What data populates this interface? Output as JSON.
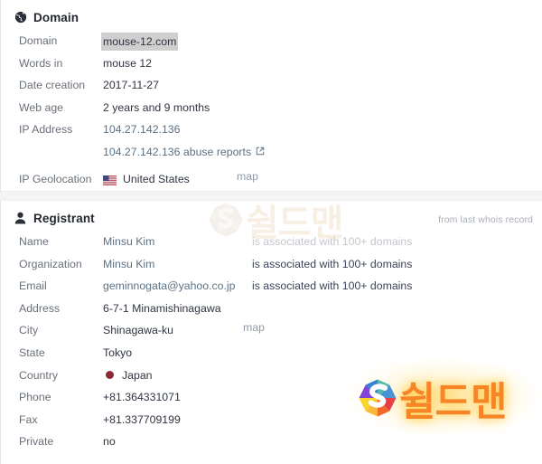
{
  "domain_section": {
    "title": "Domain",
    "icon": "globe-icon",
    "rows": [
      {
        "label": "Domain",
        "value": "mouse-12.com",
        "style": "highlight"
      },
      {
        "label": "Words in",
        "value": "mouse 12",
        "style": "text"
      },
      {
        "label": "Date creation",
        "value": "2017-11-27",
        "style": "text"
      },
      {
        "label": "Web age",
        "value": "2 years and 9 months",
        "style": "text"
      },
      {
        "label": "IP Address",
        "value": "104.27.142.136",
        "style": "link"
      }
    ],
    "abuse_row": {
      "label": "",
      "value": "104.27.142.136 abuse reports",
      "icon": "external-link-icon"
    },
    "geolocation_row": {
      "label": "IP Geolocation",
      "value": "United States",
      "flag": "us-flag-icon",
      "map_label": "map"
    }
  },
  "registrant_section": {
    "title": "Registrant",
    "icon": "person-icon",
    "note": "from last whois record",
    "assoc_text": "is associated with 100+ domains",
    "rows": [
      {
        "label": "Name",
        "value": "Minsu Kim",
        "style": "link",
        "extra": "is associated with 100+ domains",
        "extra_muted": true
      },
      {
        "label": "Organization",
        "value": "Minsu Kim",
        "style": "link",
        "extra": "is associated with 100+ domains",
        "extra_muted": false
      },
      {
        "label": "Email",
        "value": "geminnogata@yahoo.co.jp",
        "style": "link",
        "extra": "is associated with 100+ domains",
        "extra_muted": false
      },
      {
        "label": "Address",
        "value": "6-7-1 Minamishinagawa",
        "style": "text"
      },
      {
        "label": "City",
        "value": "Shinagawa-ku",
        "style": "text",
        "map_label": "map"
      },
      {
        "label": "State",
        "value": "Tokyo",
        "style": "text"
      },
      {
        "label": "Country",
        "value": "Japan",
        "style": "flag",
        "flag": "jp-flag-icon"
      },
      {
        "label": "Phone",
        "value": "+81.364331071",
        "style": "text"
      },
      {
        "label": "Fax",
        "value": "+81.337709199",
        "style": "text"
      },
      {
        "label": "Private",
        "value": "no",
        "style": "text"
      }
    ]
  },
  "watermarks": {
    "top": {
      "text": "쉴드맨",
      "emblem": "shieldman-s-logo"
    },
    "bottom": {
      "text": "쉴드맨",
      "emblem": "shieldman-s-logo"
    }
  },
  "colors": {
    "link": "#5b7184",
    "label": "#6a7079",
    "value": "#2f3440",
    "muted": "#c3c6cb",
    "note": "#a9aeb6",
    "highlight_bg": "#cfcfcf",
    "page_bg": "#f4f4f4",
    "watermark_orange": "#f58220"
  }
}
